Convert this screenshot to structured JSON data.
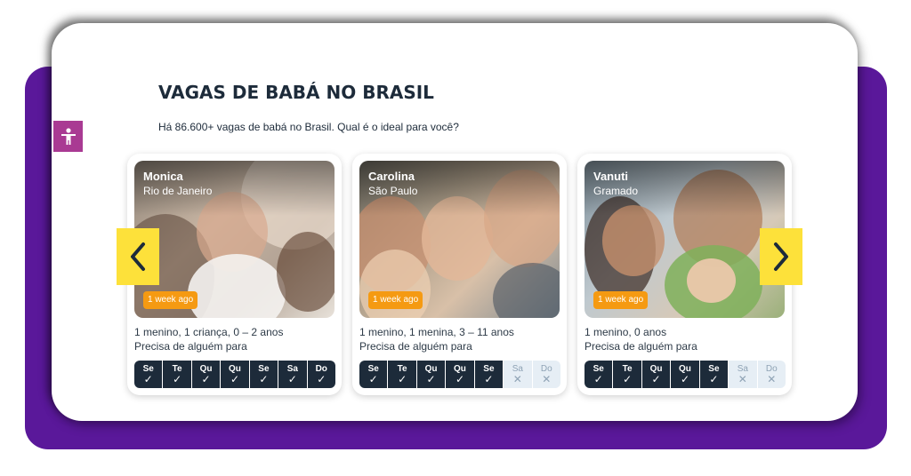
{
  "section": {
    "title": "VAGAS DE BABÁ NO BRASIL",
    "subtitle": "Há 86.600+ vagas de babá no Brasil. Qual é o ideal para você?"
  },
  "colors": {
    "brand_purple": "#5a189a",
    "navy": "#1d2b3a",
    "badge_orange": "#f59a12",
    "arrow_yellow": "#fde13a",
    "accessibility_pink": "#a93a93"
  },
  "accessibility_button": {
    "icon": "accessibility-icon"
  },
  "carousel": {
    "prev_icon": "chevron-left-icon",
    "next_icon": "chevron-right-icon",
    "cards": [
      {
        "name": "Monica",
        "city": "Rio de Janeiro",
        "posted": "1 week ago",
        "children": "1 menino, 1 criança, 0 – 2 anos",
        "need_label": "Precisa de alguém para",
        "days": [
          {
            "label": "Se",
            "active": true
          },
          {
            "label": "Te",
            "active": true
          },
          {
            "label": "Qu",
            "active": true
          },
          {
            "label": "Qu",
            "active": true
          },
          {
            "label": "Se",
            "active": true
          },
          {
            "label": "Sa",
            "active": true
          },
          {
            "label": "Do",
            "active": true
          }
        ]
      },
      {
        "name": "Carolina",
        "city": "São Paulo",
        "posted": "1 week ago",
        "children": "1 menino, 1 menina, 3 – 11 anos",
        "need_label": "Precisa de alguém para",
        "days": [
          {
            "label": "Se",
            "active": true
          },
          {
            "label": "Te",
            "active": true
          },
          {
            "label": "Qu",
            "active": true
          },
          {
            "label": "Qu",
            "active": true
          },
          {
            "label": "Se",
            "active": true
          },
          {
            "label": "Sa",
            "active": false
          },
          {
            "label": "Do",
            "active": false
          }
        ]
      },
      {
        "name": "Vanuti",
        "city": "Gramado",
        "posted": "1 week ago",
        "children": "1 menino, 0 anos",
        "need_label": "Precisa de alguém para",
        "days": [
          {
            "label": "Se",
            "active": true
          },
          {
            "label": "Te",
            "active": true
          },
          {
            "label": "Qu",
            "active": true
          },
          {
            "label": "Qu",
            "active": true
          },
          {
            "label": "Se",
            "active": true
          },
          {
            "label": "Sa",
            "active": false
          },
          {
            "label": "Do",
            "active": false
          }
        ]
      }
    ]
  }
}
